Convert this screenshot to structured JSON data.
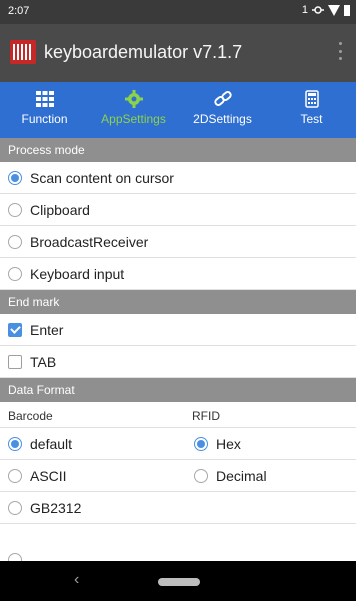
{
  "status_bar": {
    "time": "2:07",
    "notification_count": "1"
  },
  "app_bar": {
    "title": "keyboardemulator v7.1.7"
  },
  "tabs": [
    {
      "label": "Function"
    },
    {
      "label": "AppSettings"
    },
    {
      "label": "2DSettings"
    },
    {
      "label": "Test"
    }
  ],
  "colors": {
    "tab_bar": "#2f6fd1",
    "active_tab": "#8bd34a",
    "accent": "#4a90e2",
    "section_header": "#8f8f8f"
  },
  "process_mode": {
    "header": "Process mode",
    "options": [
      {
        "label": "Scan content on cursor",
        "selected": true
      },
      {
        "label": "Clipboard",
        "selected": false
      },
      {
        "label": "BroadcastReceiver",
        "selected": false
      },
      {
        "label": "Keyboard input",
        "selected": false
      }
    ]
  },
  "end_mark": {
    "header": "End mark",
    "options": [
      {
        "label": "Enter",
        "checked": true
      },
      {
        "label": "TAB",
        "checked": false
      }
    ]
  },
  "data_format": {
    "header": "Data Format",
    "barcode_header": "Barcode",
    "rfid_header": "RFID",
    "barcode_options": [
      {
        "label": "default",
        "selected": true
      },
      {
        "label": "ASCII",
        "selected": false
      },
      {
        "label": "GB2312",
        "selected": false
      }
    ],
    "rfid_options": [
      {
        "label": "Hex",
        "selected": true
      },
      {
        "label": "Decimal",
        "selected": false
      }
    ]
  },
  "nav_bar": {
    "back_icon": "chevron-left-icon",
    "home_icon": "home-pill-icon"
  }
}
